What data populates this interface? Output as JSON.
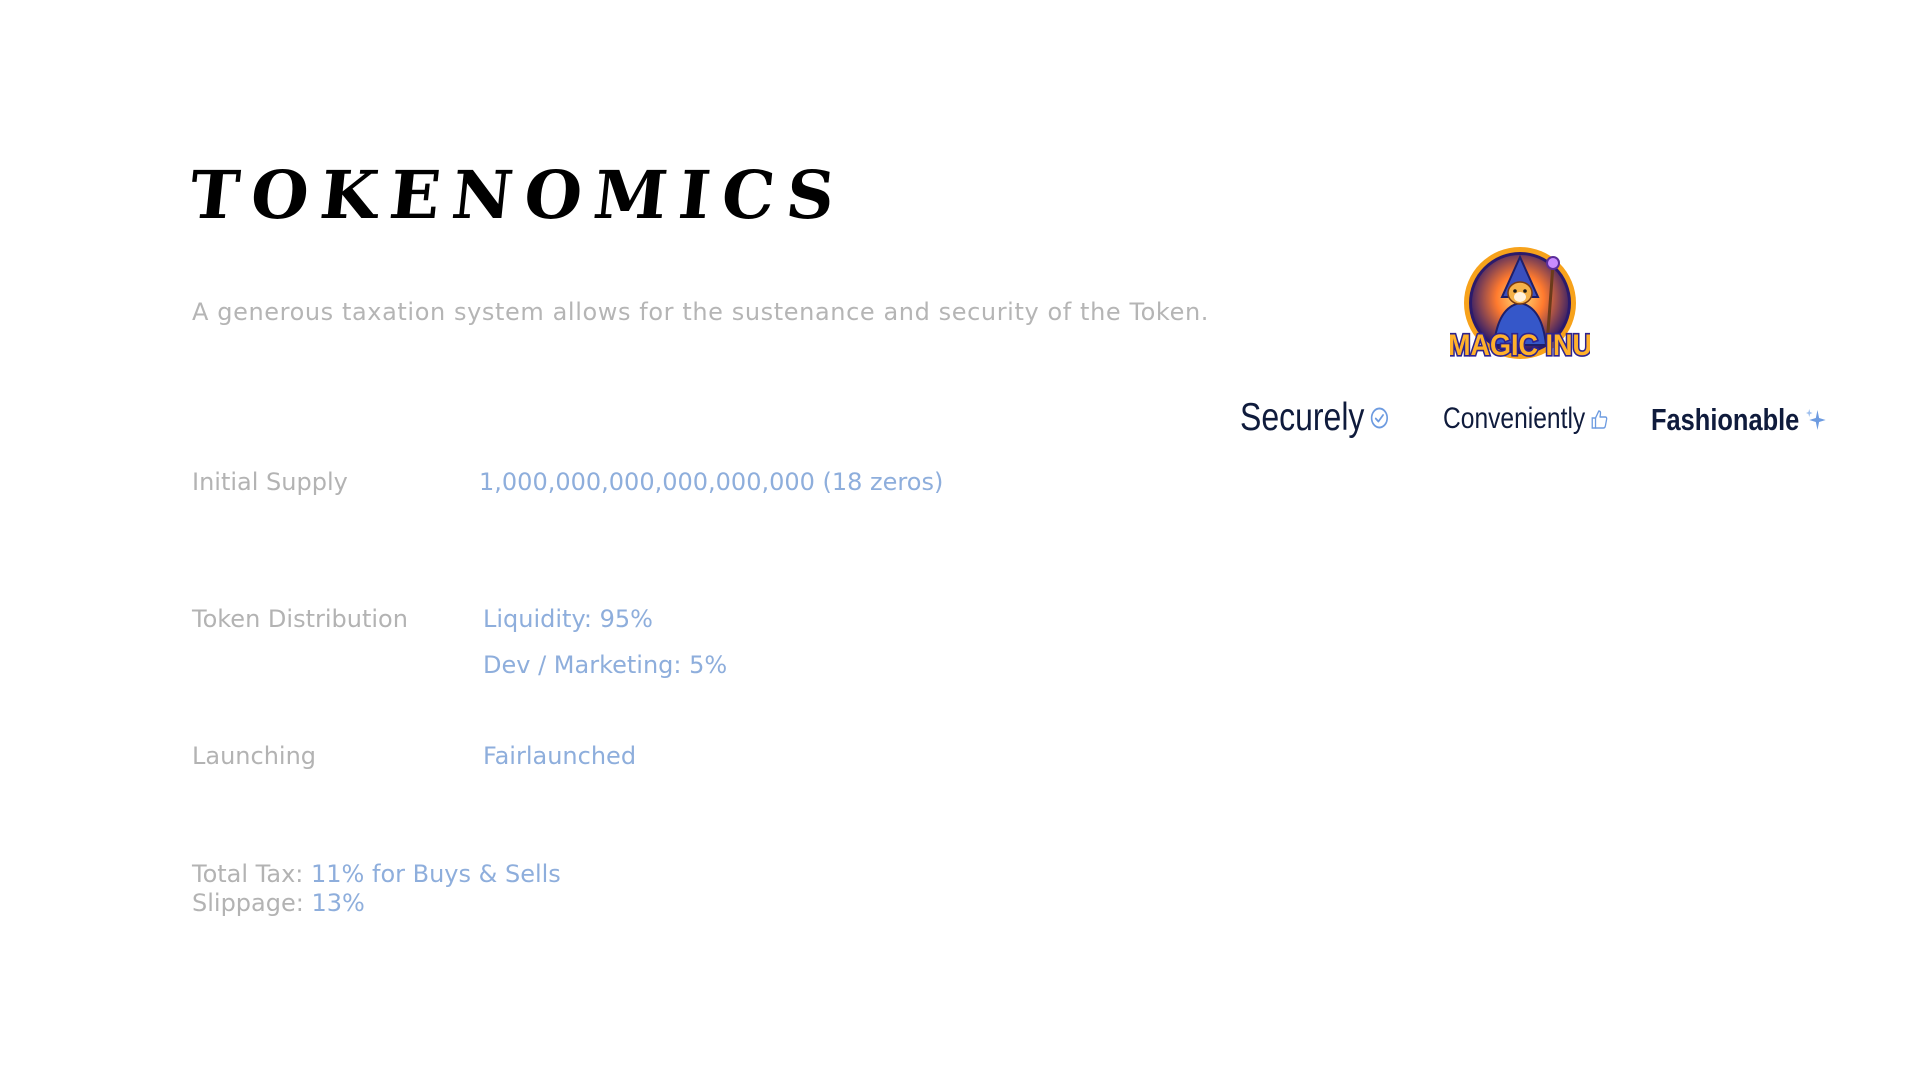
{
  "header": {
    "title": "TOKENOMICS",
    "subtitle": "A generous taxation system allows for the sustenance and security of the Token."
  },
  "logo": {
    "text": "MAGIC INU",
    "colors": {
      "ring": "#f7a21b",
      "inner": "#2b1a6b",
      "glow": "#ff7a2e",
      "wordmark_fill": "#ffb12b",
      "wordmark_outline": "#2d2390"
    }
  },
  "features": [
    {
      "label": "Securely",
      "icon": "check-circle-icon"
    },
    {
      "label": "Conveniently",
      "icon": "thumbs-up-icon"
    },
    {
      "label": "Fashionable",
      "icon": "sparkles-icon"
    }
  ],
  "tokenomics": {
    "initial_supply": {
      "label": "Initial Supply",
      "value": "1,000,000,000,000,000,000 (18 zeros)"
    },
    "distribution": {
      "label": "Token Distribution",
      "items": [
        "Liquidity: 95%",
        "Dev / Marketing: 5%"
      ]
    },
    "launching": {
      "label": "Launching",
      "value": "Fairlaunched"
    },
    "tax": {
      "label": "Total Tax:",
      "value": "11% for Buys & Sells"
    },
    "slippage": {
      "label": "Slippage:",
      "value": "13%"
    }
  },
  "colors": {
    "label_gray": "#b3b3b3",
    "value_blue": "#8eaedc",
    "feature_text": "#0f1b3c",
    "icon_blue": "#6d9be0"
  }
}
